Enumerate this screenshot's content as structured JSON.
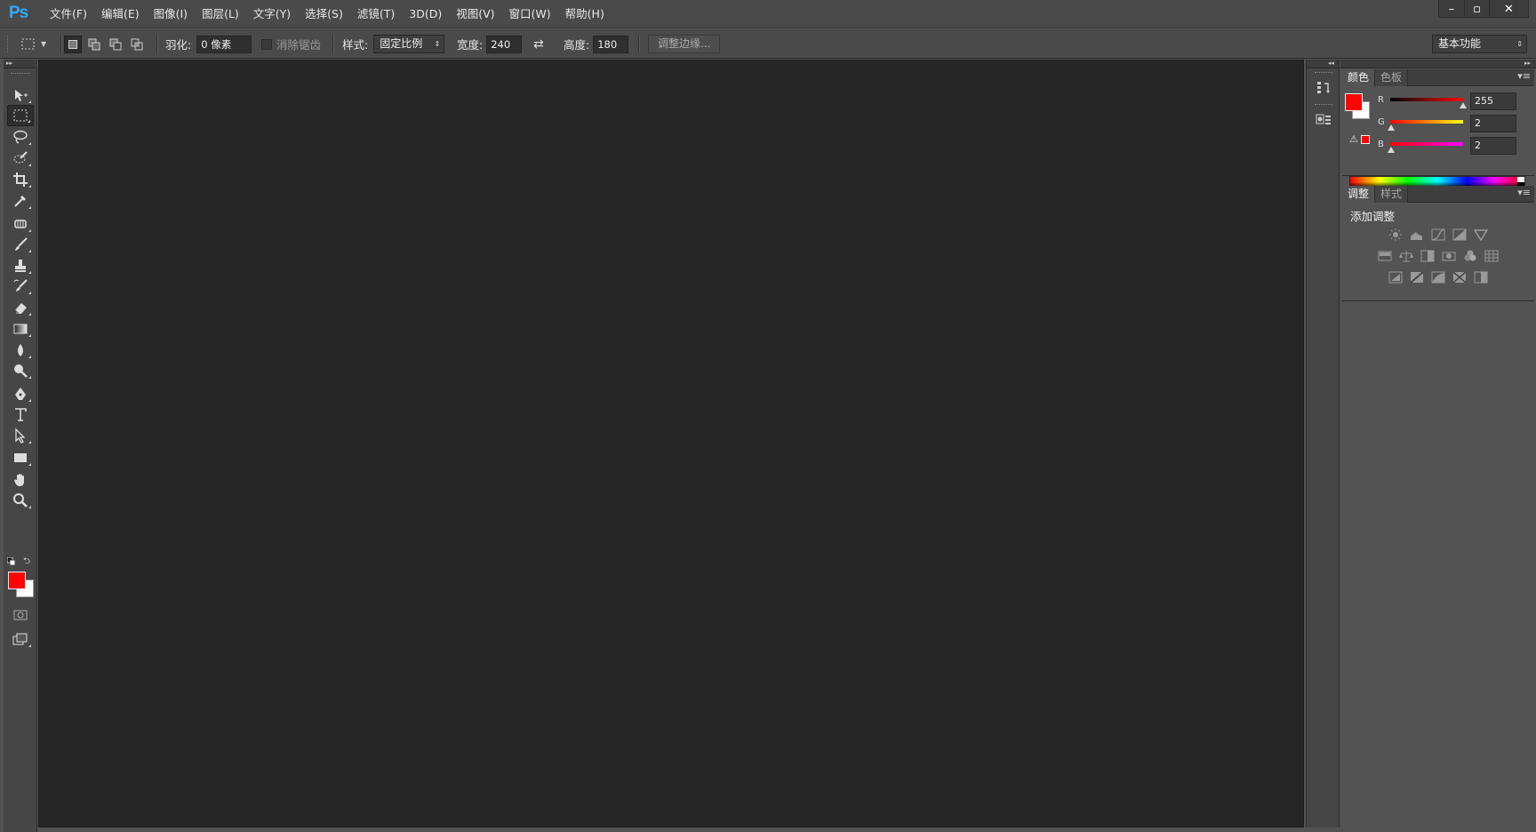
{
  "app": {
    "logo": "Ps"
  },
  "menu": [
    "文件(F)",
    "编辑(E)",
    "图像(I)",
    "图层(L)",
    "文字(Y)",
    "选择(S)",
    "滤镜(T)",
    "3D(D)",
    "视图(V)",
    "窗口(W)",
    "帮助(H)"
  ],
  "window_controls": {
    "minimize": "–",
    "restore": "▫",
    "close": "✕"
  },
  "options": {
    "feather_label": "羽化:",
    "feather_value": "0 像素",
    "antialias_label": "消除锯齿",
    "style_label": "样式:",
    "style_value": "固定比例",
    "width_label": "宽度:",
    "width_value": "240",
    "height_label": "高度:",
    "height_value": "180",
    "refine_edge": "调整边缘...",
    "workspace": "基本功能"
  },
  "tools": [
    "move-tool",
    "rectangular-marquee-tool",
    "lasso-tool",
    "quick-selection-tool",
    "crop-tool",
    "eyedropper-tool",
    "spot-healing-tool",
    "brush-tool",
    "clone-stamp-tool",
    "history-brush-tool",
    "eraser-tool",
    "gradient-tool",
    "blur-tool",
    "dodge-tool",
    "pen-tool",
    "type-tool",
    "path-selection-tool",
    "rectangle-tool",
    "hand-tool",
    "zoom-tool"
  ],
  "colors": {
    "foreground": "#ff0202",
    "background": "#ffffff",
    "accent": "#31a8ff"
  },
  "color_panel": {
    "tabs": [
      "颜色",
      "色板"
    ],
    "r_label": "R",
    "g_label": "G",
    "b_label": "B",
    "r": "255",
    "g": "2",
    "b": "2",
    "r_fraction": 1.0,
    "g_fraction": 0.008,
    "b_fraction": 0.008
  },
  "adjust_panel": {
    "tabs": [
      "调整",
      "样式"
    ],
    "heading": "添加调整",
    "rows": [
      [
        "brightness-contrast-icon",
        "levels-icon",
        "curves-icon",
        "exposure-icon",
        "vibrance-icon"
      ],
      [
        "hue-saturation-icon",
        "color-balance-icon",
        "black-white-icon",
        "photo-filter-icon",
        "channel-mixer-icon",
        "color-lookup-icon"
      ],
      [
        "invert-icon",
        "posterize-icon",
        "threshold-icon",
        "selective-color-icon",
        "gradient-map-icon"
      ]
    ]
  }
}
